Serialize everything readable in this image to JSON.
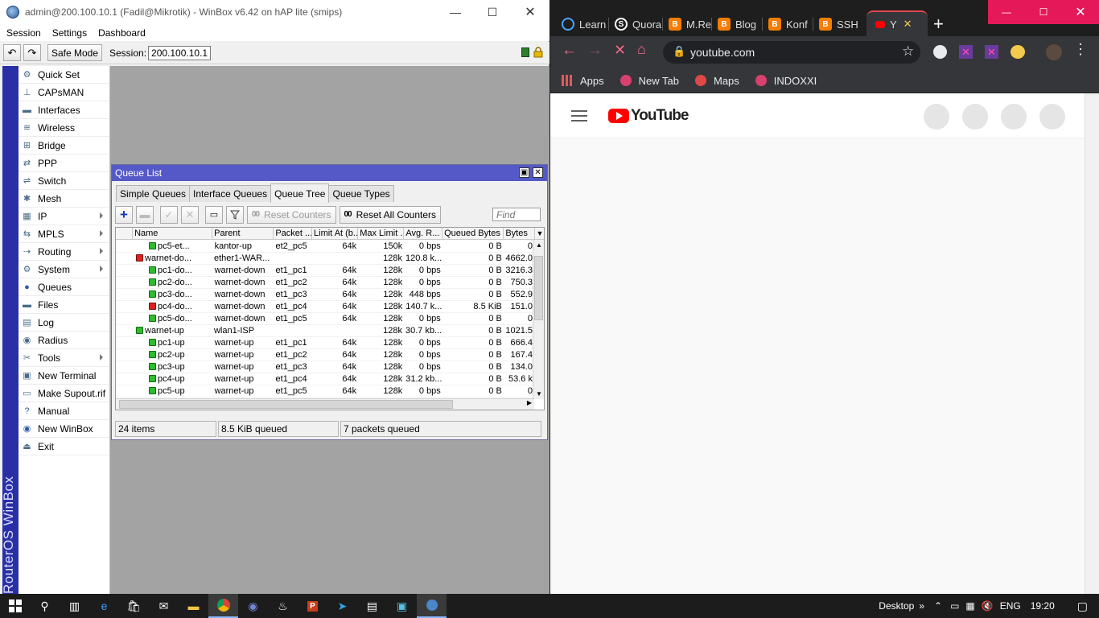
{
  "winbox": {
    "title": "admin@200.100.10.1 (Fadil@Mikrotik) - WinBox v6.42 on hAP lite (smips)",
    "menubar": [
      "Session",
      "Settings",
      "Dashboard"
    ],
    "safe_mode": "Safe Mode",
    "session_label": "Session:",
    "session_value": "200.100.10.1",
    "brand": "RouterOS WinBox",
    "menu": [
      {
        "label": "Quick Set",
        "icon": "quickset-icon",
        "submenu": false
      },
      {
        "label": "CAPsMAN",
        "icon": "capsman-icon",
        "submenu": false
      },
      {
        "label": "Interfaces",
        "icon": "interfaces-icon",
        "submenu": false
      },
      {
        "label": "Wireless",
        "icon": "wireless-icon",
        "submenu": false
      },
      {
        "label": "Bridge",
        "icon": "bridge-icon",
        "submenu": false
      },
      {
        "label": "PPP",
        "icon": "ppp-icon",
        "submenu": false
      },
      {
        "label": "Switch",
        "icon": "switch-icon",
        "submenu": false
      },
      {
        "label": "Mesh",
        "icon": "mesh-icon",
        "submenu": false
      },
      {
        "label": "IP",
        "icon": "ip-icon",
        "submenu": true
      },
      {
        "label": "MPLS",
        "icon": "mpls-icon",
        "submenu": true
      },
      {
        "label": "Routing",
        "icon": "routing-icon",
        "submenu": true
      },
      {
        "label": "System",
        "icon": "system-icon",
        "submenu": true
      },
      {
        "label": "Queues",
        "icon": "queues-icon",
        "submenu": false
      },
      {
        "label": "Files",
        "icon": "files-icon",
        "submenu": false
      },
      {
        "label": "Log",
        "icon": "log-icon",
        "submenu": false
      },
      {
        "label": "Radius",
        "icon": "radius-icon",
        "submenu": false
      },
      {
        "label": "Tools",
        "icon": "tools-icon",
        "submenu": true
      },
      {
        "label": "New Terminal",
        "icon": "terminal-icon",
        "submenu": false
      },
      {
        "label": "Make Supout.rif",
        "icon": "supout-icon",
        "submenu": false
      },
      {
        "label": "Manual",
        "icon": "manual-icon",
        "submenu": false
      },
      {
        "label": "New WinBox",
        "icon": "winbox-icon",
        "submenu": false
      },
      {
        "label": "Exit",
        "icon": "exit-icon",
        "submenu": false
      }
    ]
  },
  "queue_list": {
    "title": "Queue List",
    "tabs": [
      "Simple Queues",
      "Interface Queues",
      "Queue Tree",
      "Queue Types"
    ],
    "active_tab": "Queue Tree",
    "reset_counters": "Reset Counters",
    "reset_all_counters": "Reset All Counters",
    "counter_glyph": "00",
    "find_placeholder": "Find",
    "columns": [
      "Name",
      "Parent",
      "Packet ...",
      "Limit At (b...",
      "Max Limit ...",
      "Avg. R...",
      "Queued Bytes",
      "Bytes"
    ],
    "rows": [
      {
        "indent": 2,
        "status": "green",
        "name": "pc5-et...",
        "parent": "kantor-up",
        "packet": "et2_pc5",
        "limit_at": "64k",
        "max_limit": "150k",
        "avg_rate": "0 bps",
        "queued": "0 B",
        "bytes": "0"
      },
      {
        "indent": 1,
        "status": "red",
        "name": "warnet-do...",
        "parent": "ether1-WAR...",
        "packet": "",
        "limit_at": "",
        "max_limit": "128k",
        "avg_rate": "120.8 k...",
        "queued": "0 B",
        "bytes": "4662.0"
      },
      {
        "indent": 2,
        "status": "green",
        "name": "pc1-do...",
        "parent": "warnet-down",
        "packet": "et1_pc1",
        "limit_at": "64k",
        "max_limit": "128k",
        "avg_rate": "0 bps",
        "queued": "0 B",
        "bytes": "3216.3"
      },
      {
        "indent": 2,
        "status": "green",
        "name": "pc2-do...",
        "parent": "warnet-down",
        "packet": "et1_pc2",
        "limit_at": "64k",
        "max_limit": "128k",
        "avg_rate": "0 bps",
        "queued": "0 B",
        "bytes": "750.3"
      },
      {
        "indent": 2,
        "status": "green",
        "name": "pc3-do...",
        "parent": "warnet-down",
        "packet": "et1_pc3",
        "limit_at": "64k",
        "max_limit": "128k",
        "avg_rate": "448 bps",
        "queued": "0 B",
        "bytes": "552.9"
      },
      {
        "indent": 2,
        "status": "red",
        "name": "pc4-do...",
        "parent": "warnet-down",
        "packet": "et1_pc4",
        "limit_at": "64k",
        "max_limit": "128k",
        "avg_rate": "140.7 k...",
        "queued": "8.5 KiB",
        "bytes": "151.0"
      },
      {
        "indent": 2,
        "status": "green",
        "name": "pc5-do...",
        "parent": "warnet-down",
        "packet": "et1_pc5",
        "limit_at": "64k",
        "max_limit": "128k",
        "avg_rate": "0 bps",
        "queued": "0 B",
        "bytes": "0"
      },
      {
        "indent": 1,
        "status": "green",
        "name": "warnet-up",
        "parent": "wlan1-ISP",
        "packet": "",
        "limit_at": "",
        "max_limit": "128k",
        "avg_rate": "30.7 kb...",
        "queued": "0 B",
        "bytes": "1021.5"
      },
      {
        "indent": 2,
        "status": "green",
        "name": "pc1-up",
        "parent": "warnet-up",
        "packet": "et1_pc1",
        "limit_at": "64k",
        "max_limit": "128k",
        "avg_rate": "0 bps",
        "queued": "0 B",
        "bytes": "666.4"
      },
      {
        "indent": 2,
        "status": "green",
        "name": "pc2-up",
        "parent": "warnet-up",
        "packet": "et1_pc2",
        "limit_at": "64k",
        "max_limit": "128k",
        "avg_rate": "0 bps",
        "queued": "0 B",
        "bytes": "167.4"
      },
      {
        "indent": 2,
        "status": "green",
        "name": "pc3-up",
        "parent": "warnet-up",
        "packet": "et1_pc3",
        "limit_at": "64k",
        "max_limit": "128k",
        "avg_rate": "0 bps",
        "queued": "0 B",
        "bytes": "134.0"
      },
      {
        "indent": 2,
        "status": "green",
        "name": "pc4-up",
        "parent": "warnet-up",
        "packet": "et1_pc4",
        "limit_at": "64k",
        "max_limit": "128k",
        "avg_rate": "31.2 kb...",
        "queued": "0 B",
        "bytes": "53.6 k"
      },
      {
        "indent": 2,
        "status": "green",
        "name": "pc5-up",
        "parent": "warnet-up",
        "packet": "et1_pc5",
        "limit_at": "64k",
        "max_limit": "128k",
        "avg_rate": "0 bps",
        "queued": "0 B",
        "bytes": "0"
      }
    ],
    "status": {
      "items": "24 items",
      "queued": "8.5 KiB queued",
      "packets": "7 packets queued"
    }
  },
  "chrome": {
    "tabs": [
      {
        "label": "Learn",
        "favicon": "circle-icon",
        "color": "#4aa3ff"
      },
      {
        "label": "Quora",
        "favicon": "s-icon",
        "color": "#ffffff"
      },
      {
        "label": "M.Re",
        "favicon": "blogger-icon",
        "color": "#f57d00"
      },
      {
        "label": "Blog",
        "favicon": "blogger-icon",
        "color": "#f57d00"
      },
      {
        "label": "Konf",
        "favicon": "blogger-icon",
        "color": "#f57d00"
      },
      {
        "label": "SSH",
        "favicon": "blogger-icon",
        "color": "#f57d00"
      },
      {
        "label": "Y",
        "favicon": "youtube-icon",
        "color": "#ff0000"
      }
    ],
    "url": "youtube.com",
    "bookmarks": [
      {
        "label": "Apps",
        "icon": "apps-grid-icon"
      },
      {
        "label": "New Tab",
        "icon": "newtab-icon"
      },
      {
        "label": "Maps",
        "icon": "maps-icon"
      },
      {
        "label": "INDOXXI",
        "icon": "indoxxi-icon"
      }
    ],
    "page_brand": "YouTube"
  },
  "taskbar": {
    "desktop": "Desktop",
    "language": "ENG",
    "time": "19:20"
  }
}
